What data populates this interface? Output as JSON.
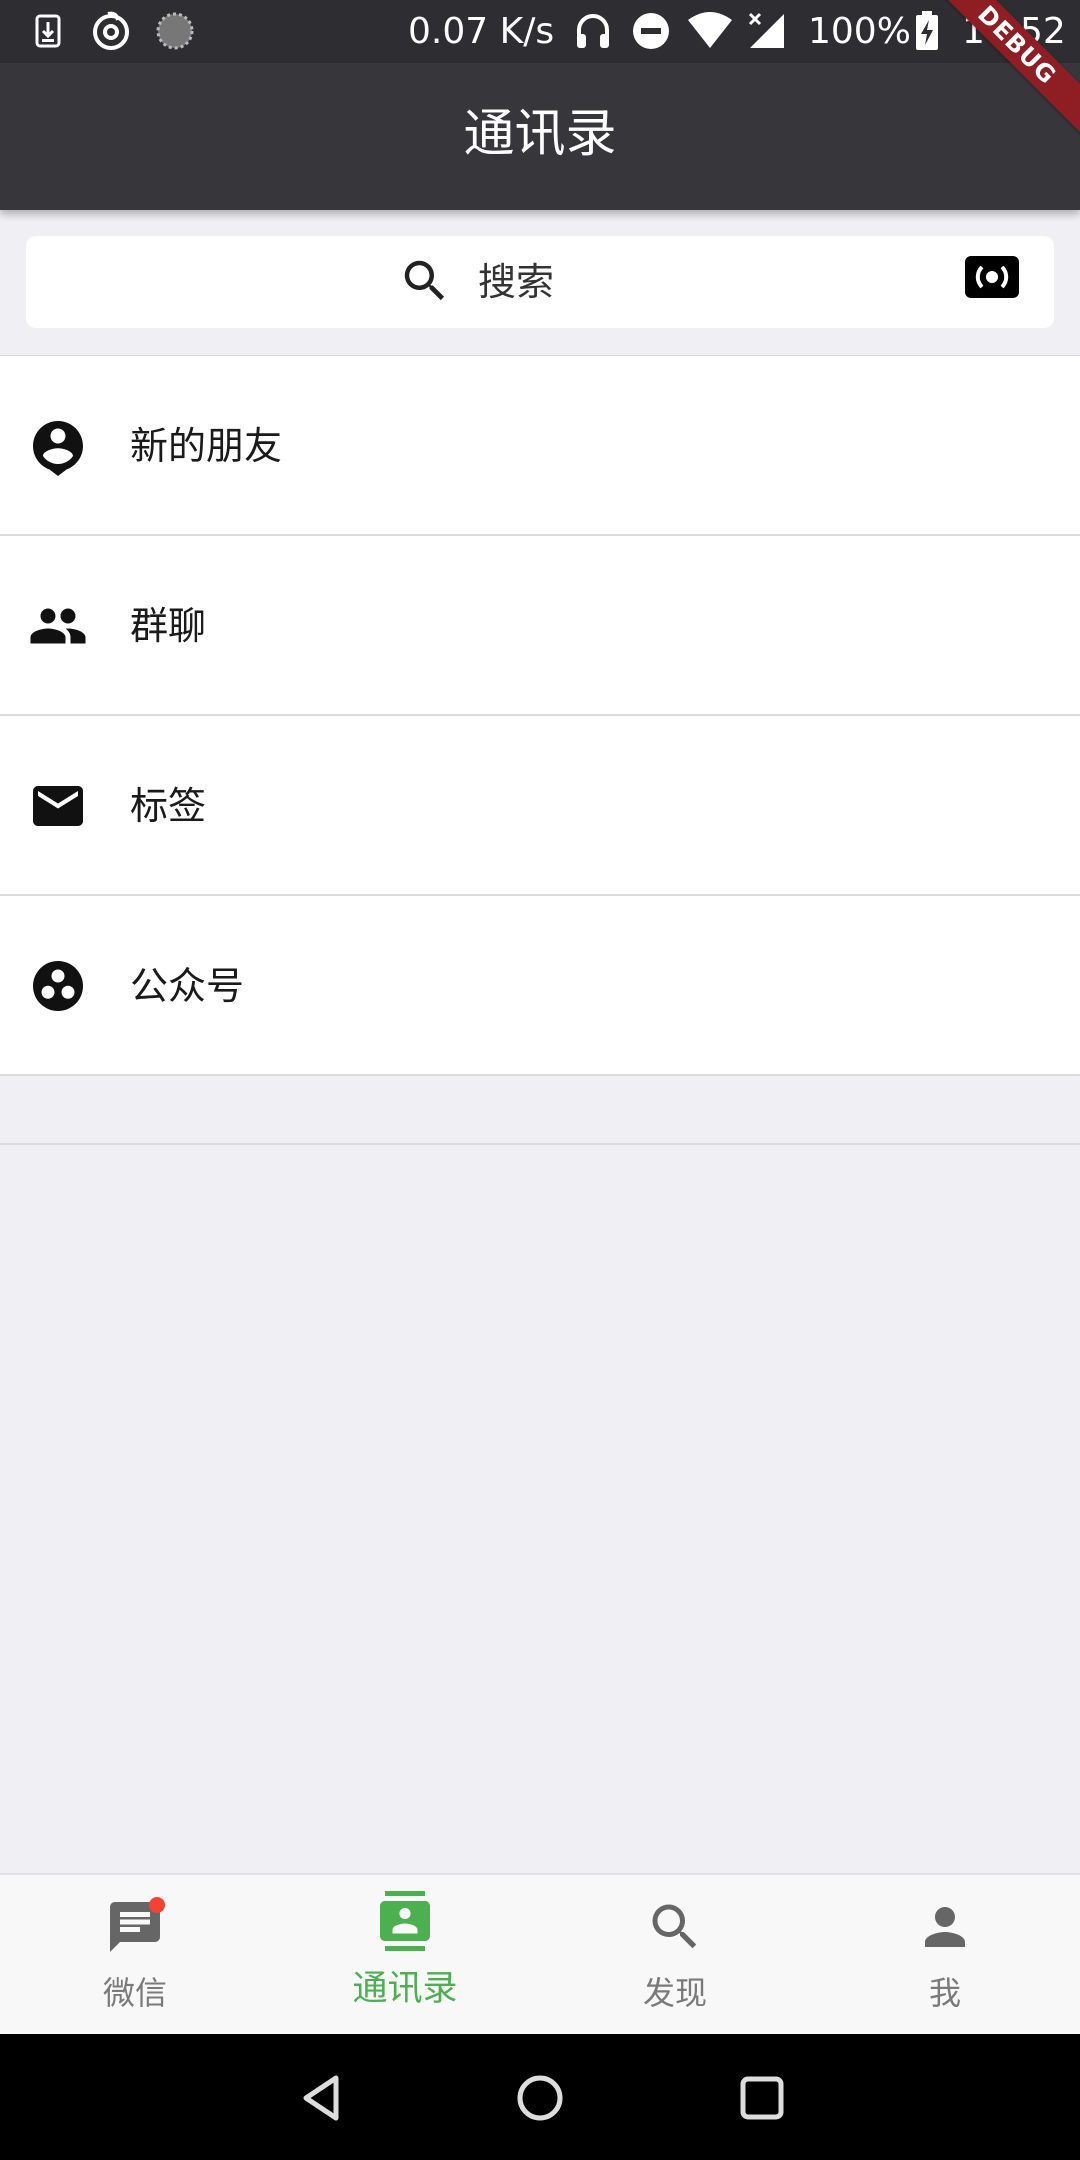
{
  "status_bar": {
    "net_speed": "0.07 K/s",
    "battery": "100%",
    "time": "16:52",
    "icons": [
      "download-icon",
      "netease-music-icon",
      "loading-icon",
      "headphones-icon",
      "do-not-disturb-icon",
      "wifi-icon",
      "signal-icon",
      "battery-charging-icon"
    ]
  },
  "debug_banner": "DEBUG",
  "app_bar": {
    "title": "通讯录"
  },
  "search": {
    "placeholder": "搜索",
    "icon": "search-icon",
    "trailing_icon": "voice-recognition-icon"
  },
  "menu": {
    "items": [
      {
        "label": "新的朋友",
        "icon": "account-circle-icon"
      },
      {
        "label": "群聊",
        "icon": "people-icon"
      },
      {
        "label": "标签",
        "icon": "mail-icon"
      },
      {
        "label": "公众号",
        "icon": "bubble-chart-icon"
      }
    ]
  },
  "bottom_nav": {
    "items": [
      {
        "label": "微信",
        "icon": "chat-icon",
        "active": false,
        "badge": true
      },
      {
        "label": "通讯录",
        "icon": "contacts-icon",
        "active": true
      },
      {
        "label": "发现",
        "icon": "search-icon",
        "active": false
      },
      {
        "label": "我",
        "icon": "person-icon",
        "active": false
      }
    ]
  },
  "colors": {
    "status_bar_bg": "#2e2e32",
    "app_bar_bg": "#37363b",
    "page_bg": "#efeff4",
    "accent": "#4caf50",
    "badge": "#f44336",
    "debug_ribbon": "#8e1e23"
  }
}
